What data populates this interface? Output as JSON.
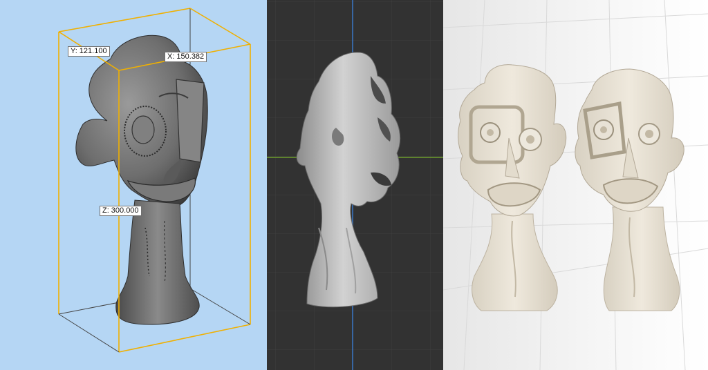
{
  "viewer": {
    "dimensions": [
      {
        "axis": "Y:",
        "value": "121.100"
      },
      {
        "axis": "X:",
        "value": "150.382"
      },
      {
        "axis": "Z:",
        "value": "300.000"
      }
    ]
  },
  "colors": {
    "viewer_background": "#b5d6f4",
    "bounding_box": "#f0b000",
    "viewport_background": "#323232",
    "x_axis": "#6c9c2c",
    "z_axis": "#3a78c8",
    "model_gray": "#6e6e6e",
    "print_cream": "#e8e2d6"
  }
}
